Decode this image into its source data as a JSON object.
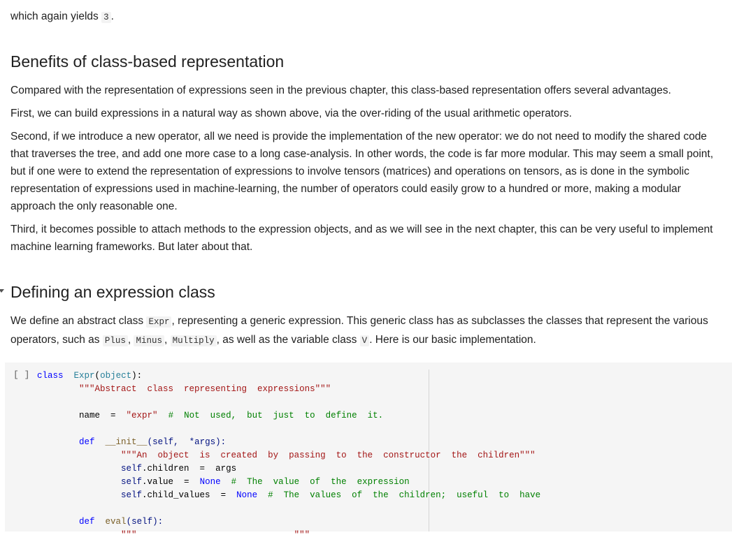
{
  "intro": {
    "text_before": "which again yields ",
    "code": "3",
    "text_after": "."
  },
  "benefits": {
    "heading": "Benefits of class-based representation",
    "paragraphs": [
      "Compared with the representation of expressions seen in the previous chapter, this class-based representation offers several advantages.",
      "First, we can build expressions in a natural way as shown above, via the over-riding of the usual arithmetic operators.",
      "Second, if we introduce a new operator, all we need is provide the implementation of the new operator: we do not need to modify the shared code that traverses the tree, and add one more case to a long case-analysis. In other words, the code is far more modular. This may seem a small point, but if one were to extend the representation of expressions to involve tensors (matrices) and operations on tensors, as is done in the symbolic representation of expressions used in machine-learning, the number of operators could easily grow to a hundred or more, making a modular approach the only reasonable one.",
      "Third, it becomes possible to attach methods to the expression objects, and as we will see in the next chapter, this can be very useful to implement machine learning frameworks. But later about that."
    ]
  },
  "defining": {
    "heading": "Defining an expression class",
    "p1": "We define an abstract class ",
    "c1": "Expr",
    "p2": ", representing a generic expression. This generic class has as subclasses the classes that represent the various operators, such as ",
    "c2": "Plus",
    "p3": ", ",
    "c3": "Minus",
    "p4": ", ",
    "c4": "Multiply",
    "p5": ", as well as the variable class ",
    "c5": "V",
    "p6": ". Here is our basic implementation."
  },
  "code_cell": {
    "run_indicator": "[ ]",
    "lines": {
      "l1_kw": "class",
      "l1_name": "Expr",
      "l1_paren_open": "(",
      "l1_base": "object",
      "l1_end": "):",
      "l2_doc": "\"\"\"Abstract  class  representing  expressions\"\"\"",
      "l4_name": "name",
      "l4_eq": "  =  ",
      "l4_str": "\"expr\"",
      "l4_cm": "  #  Not  used,  but  just  to  define  it.",
      "l6_kw": "def",
      "l6_fn": "__init__",
      "l6_args": "(self,  *args):",
      "l7_doc": "\"\"\"An  object  is  created  by  passing  to  the  constructor  the  children\"\"\"",
      "l8_self": "self",
      "l8_rest": ".children  =  args",
      "l9_self": "self",
      "l9_rest": ".value  =  ",
      "l9_none": "None",
      "l9_cm": "  #  The  value  of  the  expression",
      "l10_self": "self",
      "l10_rest": ".child_values  =  ",
      "l10_none": "None",
      "l10_cm": "  #  The  values  of  the  children;  useful  to  have",
      "l12_kw": "def",
      "l12_fn": "eval",
      "l12_args": "(self):",
      "l13_doc": "\"\"\"                              \"\"\""
    }
  }
}
